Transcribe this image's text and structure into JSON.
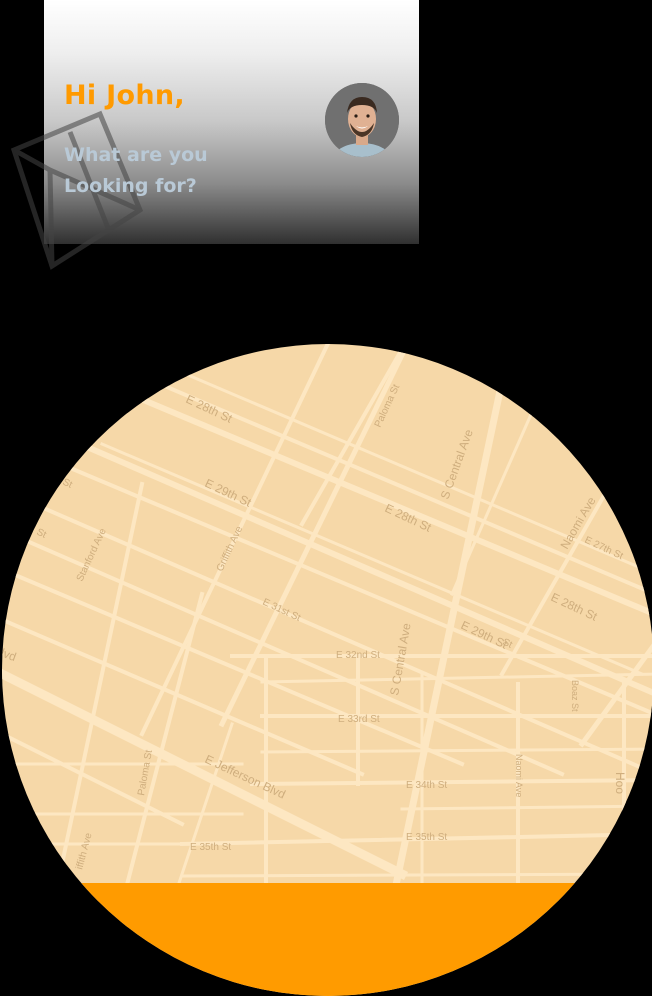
{
  "header": {
    "greeting": "Hi John,",
    "subtitle_line1": "What are you",
    "subtitle_line2": "Looking for?"
  },
  "colors": {
    "accent": "#ff9a00",
    "map_fill": "#f6d8a8",
    "map_road": "#fde7c2",
    "map_label": "#cfae7e",
    "bottom_bar": "#ff9b00",
    "subtitle": "#b9c9d6"
  },
  "map": {
    "labels": [
      "E 28th St",
      "Paloma St",
      "S Central Ave",
      "E 29th St",
      "Naomi Ave",
      "E 28th St",
      "E 27th St",
      "Griffith Ave",
      "Stanford Ave",
      "St",
      "E 31st St",
      "E 28th St",
      "E 29th St",
      "S Central Ave",
      "E 32nd St",
      "lvd",
      "Boaz St",
      "E 33rd St",
      "E Jefferson Blvd",
      "Paloma St",
      "E 34th St",
      "Naomi Ave",
      "Hoo",
      "E 35th St",
      "E 35th St",
      "iffith Ave",
      "St",
      "St"
    ]
  }
}
